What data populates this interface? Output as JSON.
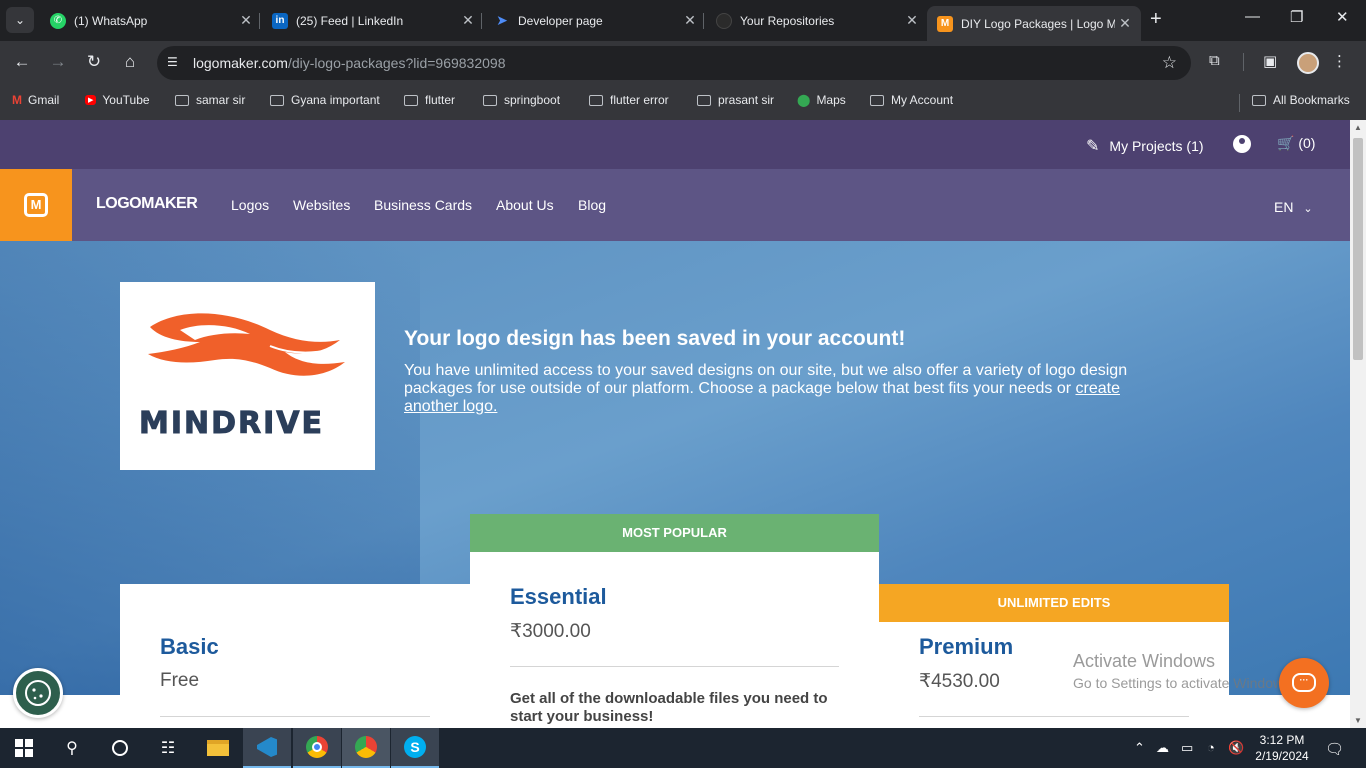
{
  "browser": {
    "tabs": [
      {
        "title": "(1) WhatsApp",
        "icon": "whatsapp-icon",
        "color": "#25d366"
      },
      {
        "title": "(25) Feed | LinkedIn",
        "icon": "linkedin-icon",
        "color": "#0a66c2"
      },
      {
        "title": "Developer page",
        "icon": "developer-icon",
        "color": "#4e8cf7"
      },
      {
        "title": "Your Repositories",
        "icon": "github-icon",
        "color": "#2b2b2b"
      },
      {
        "title": "DIY Logo Packages | Logo M",
        "icon": "logomaker-icon",
        "color": "#f7941d"
      }
    ],
    "url_host": "logomaker.com",
    "url_path": "/diy-logo-packages?lid=969832098",
    "bookmarks": [
      {
        "label": "Gmail",
        "icon": "gmail-icon"
      },
      {
        "label": "YouTube",
        "icon": "youtube-icon"
      },
      {
        "label": "samar sir",
        "icon": "folder-icon"
      },
      {
        "label": "Gyana important",
        "icon": "folder-icon"
      },
      {
        "label": "flutter",
        "icon": "folder-icon"
      },
      {
        "label": "springboot",
        "icon": "folder-icon"
      },
      {
        "label": "flutter error",
        "icon": "folder-icon"
      },
      {
        "label": "prasant sir",
        "icon": "folder-icon"
      },
      {
        "label": "Maps",
        "icon": "maps-icon"
      },
      {
        "label": "My Account",
        "icon": "folder-icon"
      }
    ],
    "all_bookmarks": "All Bookmarks"
  },
  "site": {
    "my_projects": "My Projects (1)",
    "cart": "(0)",
    "brand": "LOGOMAKER",
    "nav": [
      "Logos",
      "Websites",
      "Business Cards",
      "About Us",
      "Blog"
    ],
    "lang": "EN",
    "colors": {
      "topbar": "#4d4170",
      "navbar": "#5d5585",
      "accent": "#f7941d",
      "heading_blue": "#1d5a9c",
      "popular_green": "#6ab272",
      "unlimited_orange": "#f5a623"
    }
  },
  "hero": {
    "logo_text": "MINDRIVE",
    "title": "Your logo design has been saved in your account!",
    "text": "You have unlimited access to your saved designs on our site, but we also offer a variety of logo design packages for use outside of our platform. Choose a package below that best fits your needs or ",
    "link": "create another logo."
  },
  "packages": [
    {
      "ribbon": "",
      "name": "Basic",
      "price": "Free",
      "desc": ""
    },
    {
      "ribbon": "MOST POPULAR",
      "name": "Essential",
      "price": "₹3000.00",
      "desc": "Get all of the downloadable files you need to start your business!"
    },
    {
      "ribbon": "UNLIMITED EDITS",
      "name": "Premium",
      "price": "₹4530.00",
      "desc": ""
    }
  ],
  "watermark": {
    "line1": "Activate Windows",
    "line2": "Go to Settings to activate Windows."
  },
  "taskbar": {
    "time": "3:12 PM",
    "date": "2/19/2024"
  }
}
